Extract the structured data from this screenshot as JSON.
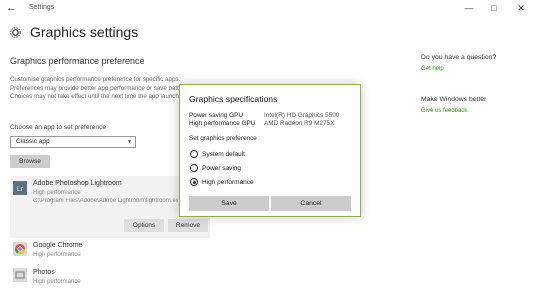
{
  "window": {
    "title": "Settings",
    "back_glyph": "←",
    "minimize_glyph": "—",
    "maximize_glyph": "□",
    "close_glyph": "✕"
  },
  "page": {
    "title": "Graphics settings",
    "section_title": "Graphics performance preference",
    "description": "Customise graphics performance preference for specific apps. Preferences may provide better app performance or save battery life. Choices may not take effect until the next time the app launches.",
    "choose_label": "Choose an app to set preference",
    "dropdown_value": "Classic app",
    "browse_label": "Browse"
  },
  "apps": [
    {
      "name": "Adobe Photoshop Lightroom",
      "pref": "High performance",
      "path": "C:\\Program Files\\Adobe\\Adobe Lightroom\\lightroom.exe",
      "icon": "lightroom-icon",
      "icon_text": "Lr"
    },
    {
      "name": "Google Chrome",
      "pref": "High performance",
      "icon": "chrome-icon"
    },
    {
      "name": "Photos",
      "pref": "High performance",
      "icon": "photos-icon"
    }
  ],
  "app_actions": {
    "options_label": "Options",
    "remove_label": "Remove"
  },
  "sidebar": {
    "question_title": "Do you have a question?",
    "question_link": "Get help",
    "improve_title": "Make Windows better",
    "improve_link": "Give us feedback"
  },
  "dialog": {
    "title": "Graphics specifications",
    "specs": [
      {
        "label": "Power saving GPU",
        "value": "Intel(R) HD Graphics 5500"
      },
      {
        "label": "High performance GPU",
        "value": "AMD Radeon R9 M275X"
      }
    ],
    "pref_label": "Set graphics preference",
    "options": [
      {
        "label": "System default",
        "selected": false
      },
      {
        "label": "Power saving",
        "selected": false
      },
      {
        "label": "High performance",
        "selected": true
      }
    ],
    "save_label": "Save",
    "cancel_label": "Cancel"
  },
  "colors": {
    "accent": "#8ab04a",
    "link": "#2f8d1f",
    "button": "#cccccc",
    "selected_card": "#f2f2f2"
  }
}
